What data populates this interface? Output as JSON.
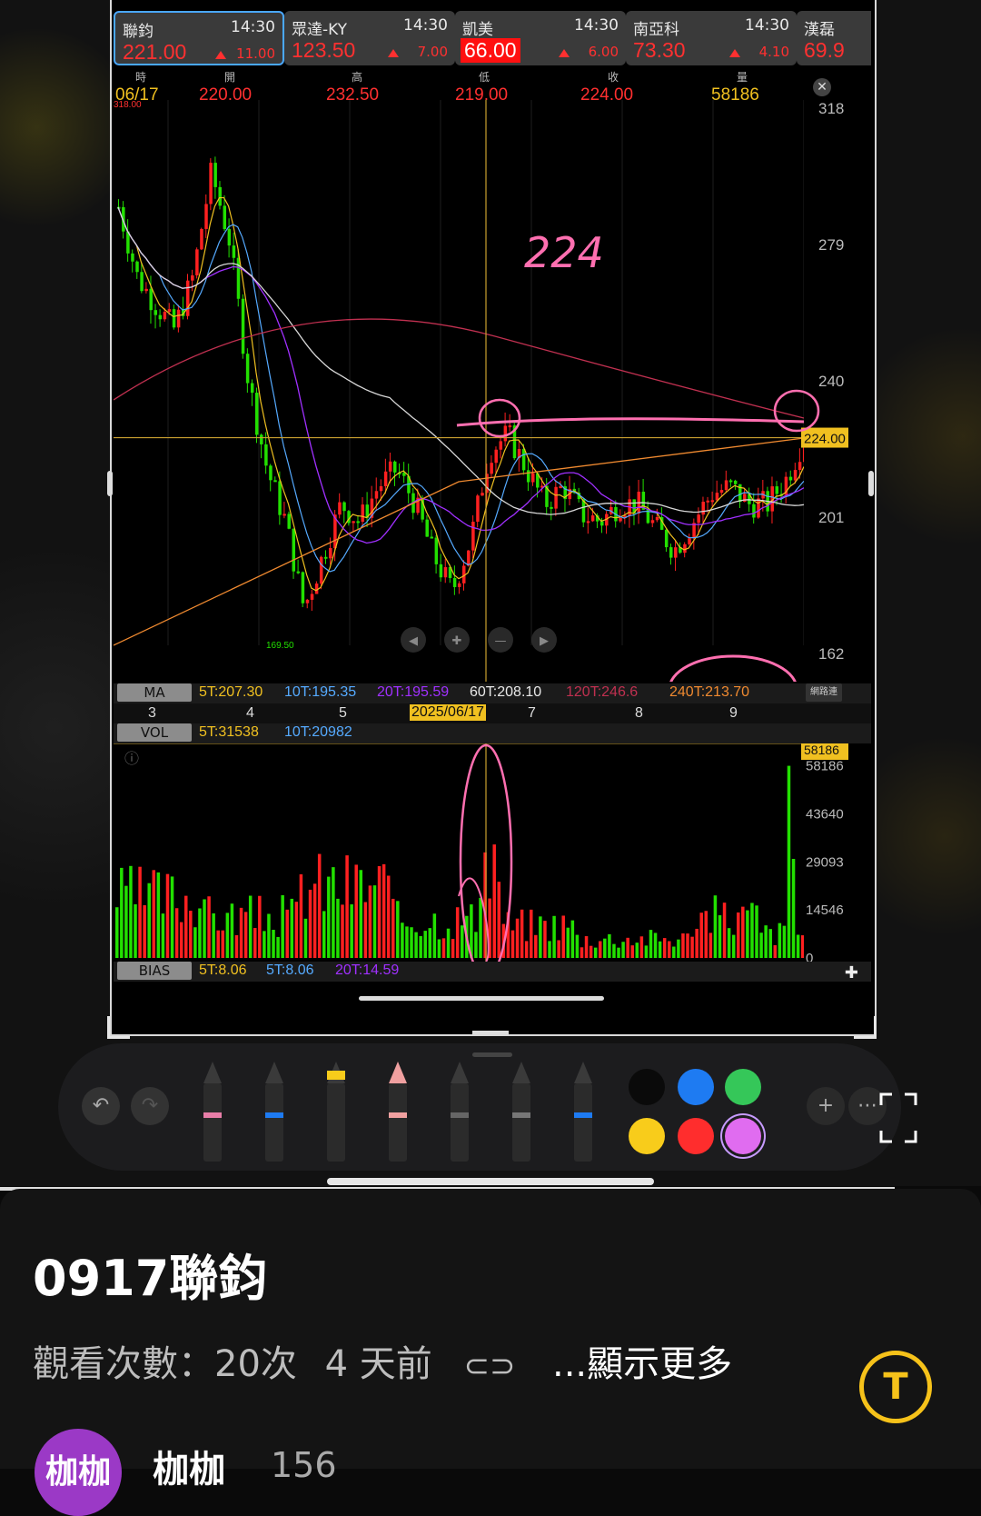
{
  "quotes": [
    {
      "name": "聯鈞",
      "time": "14:30",
      "price": "221.00",
      "change": "11.00",
      "active": true,
      "boxed": false
    },
    {
      "name": "眾達-KY",
      "time": "14:30",
      "price": "123.50",
      "change": "7.00",
      "active": false,
      "boxed": false
    },
    {
      "name": "凱美",
      "time": "14:30",
      "price": "66.00",
      "change": "6.00",
      "active": false,
      "boxed": true
    },
    {
      "name": "南亞科",
      "time": "14:30",
      "price": "73.30",
      "change": "4.10",
      "active": false,
      "boxed": false
    },
    {
      "name": "漢磊",
      "time": "",
      "price": "69.9",
      "change": "",
      "active": false,
      "boxed": false
    }
  ],
  "ohlc": {
    "headers": [
      "時",
      "開",
      "高",
      "低",
      "收",
      "量"
    ],
    "date": "06/17",
    "open": "220.00",
    "high": "232.50",
    "low": "219.00",
    "close": "224.00",
    "volume": "58186"
  },
  "price_axis": {
    "ticks": [
      "318",
      "279",
      "240",
      "201",
      "162"
    ],
    "marker": "224.00",
    "low_label": "169.50",
    "top_label": "318.00"
  },
  "handwriting": "224",
  "ma": {
    "label": "MA",
    "values": [
      "5T:207.30",
      "10T:195.35",
      "20T:195.59",
      "60T:208.10",
      "120T:246.6",
      "240T:213.70"
    ],
    "button": "網路連"
  },
  "months": {
    "labels": [
      "3",
      "4",
      "5",
      "7",
      "8",
      "9"
    ],
    "cursor_date": "2025/06/17"
  },
  "vol": {
    "label": "VOL",
    "values": [
      "5T:31538",
      "10T:20982"
    ],
    "marker": "58186",
    "ticks": [
      "58186",
      "43640",
      "29093",
      "14546",
      "0"
    ]
  },
  "bias": {
    "label": "BIAS",
    "values": [
      "5T:8.06",
      "5T:8.06",
      "20T:14.59"
    ]
  },
  "colors": {
    "up": "#ff2020",
    "down": "#22e000",
    "accent": "#4aa8ff",
    "ink": "#ff6fb0",
    "gold": "#f0c020"
  },
  "toolbar": {
    "undo_icon": "undo-icon",
    "redo_icon": "redo-icon",
    "tools": [
      "pen-pink",
      "pen-blue",
      "marker-yellow",
      "eraser",
      "pencil",
      "ruler",
      "pen-fine-blue"
    ],
    "swatches": [
      "#0a0a0a",
      "#1e7bf2",
      "#35c759",
      "#f8cc1b",
      "#ff2d2d",
      "#e06cf0"
    ]
  },
  "video": {
    "title": "0917聯鈞",
    "views": "觀看次數：20次",
    "age": "4 天前",
    "more": "...顯示更多",
    "channel": "枷枷",
    "subs": "156",
    "avatar_text": "枷枷"
  }
}
